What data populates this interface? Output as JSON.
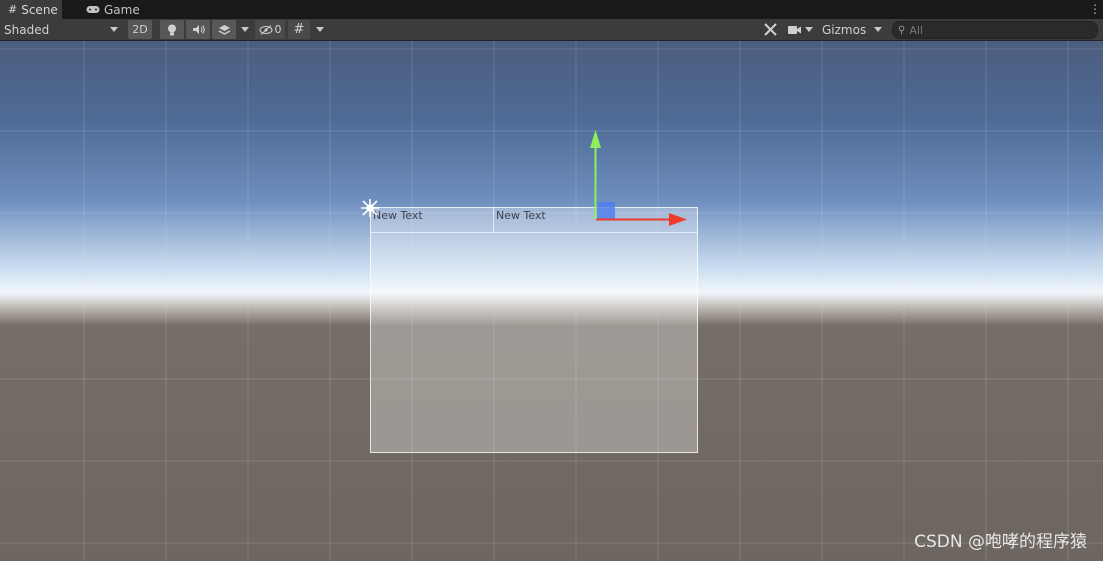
{
  "tabs": [
    {
      "label": "Scene",
      "icon": "grid-icon",
      "active": true
    },
    {
      "label": "Game",
      "icon": "gamepad-icon",
      "active": false
    }
  ],
  "toolbar": {
    "draw_mode": "Shaded",
    "mode_2d": "2D",
    "hidden_count": "0",
    "gizmos_label": "Gizmos",
    "search_placeholder": "All"
  },
  "scene": {
    "cells": [
      "New Text",
      "New Text"
    ],
    "gizmo_colors": {
      "y_axis": "#8cf05a",
      "x_axis": "#ee3b2a",
      "z_plane": "#4f7cf0"
    }
  },
  "watermark": "CSDN @咆哮的程序猿"
}
